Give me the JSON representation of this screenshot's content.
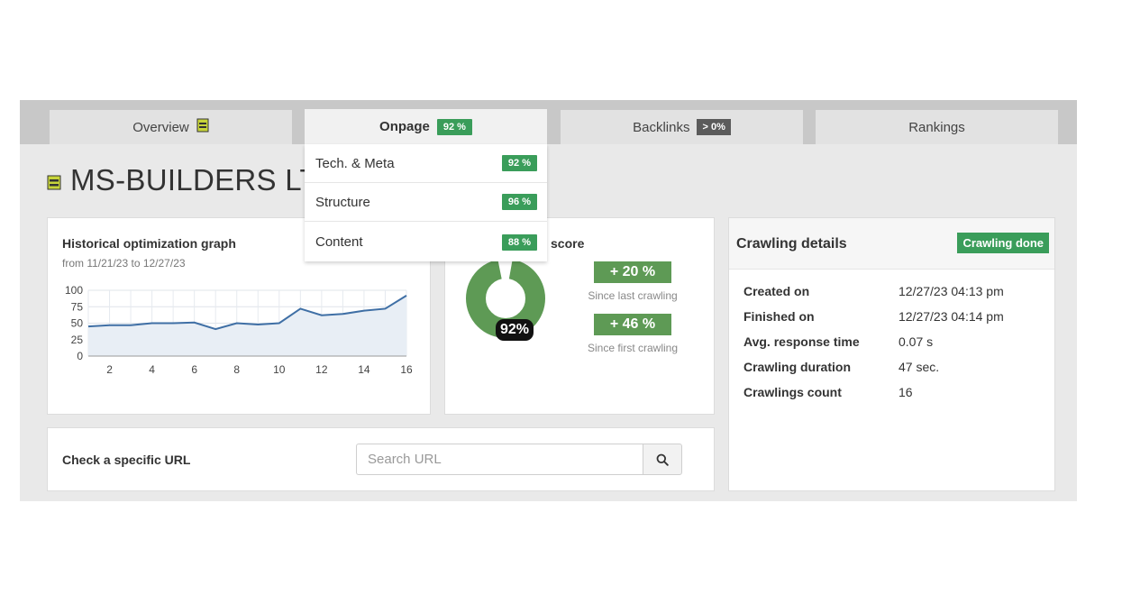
{
  "tabs": [
    {
      "label": "Overview",
      "icon": "document-icon",
      "active": false
    },
    {
      "label": "Onpage",
      "badge": "92 %",
      "active": true
    },
    {
      "label": "Backlinks",
      "badge": "> 0%",
      "active": false
    },
    {
      "label": "Rankings",
      "active": false
    }
  ],
  "page": {
    "title": "MS-BUILDERS LT",
    "title_icon": "document-icon"
  },
  "onpage_menu": [
    {
      "label": "Tech. & Meta",
      "badge": "92 %"
    },
    {
      "label": "Structure",
      "badge": "96 %"
    },
    {
      "label": "Content",
      "badge": "88 %"
    }
  ],
  "history": {
    "title": "Historical optimization graph",
    "subtitle": "from 11/21/23 to 12/27/23"
  },
  "chart_data": {
    "type": "area",
    "x": [
      1,
      2,
      3,
      4,
      5,
      6,
      7,
      8,
      9,
      10,
      11,
      12,
      13,
      14,
      15,
      16
    ],
    "series": [
      {
        "values": [
          45,
          47,
          47,
          50,
          50,
          51,
          41,
          50,
          48,
          50,
          72,
          62,
          64,
          69,
          72,
          92
        ]
      }
    ],
    "xticks": [
      2,
      4,
      6,
      8,
      10,
      12,
      14,
      16
    ],
    "yticks": [
      0,
      25,
      50,
      75,
      100
    ],
    "ylim": [
      0,
      100
    ],
    "grid": true,
    "color": "#3f6fa5"
  },
  "score": {
    "title_visible": "score",
    "value": 92,
    "label": "92%",
    "deltas": [
      {
        "value": "+ 20 %",
        "caption": "Since last crawling"
      },
      {
        "value": "+ 46 %",
        "caption": "Since first crawling"
      }
    ],
    "color": "#5e9a55"
  },
  "crawl": {
    "title": "Crawling details",
    "status": "Crawling done",
    "rows": [
      {
        "key": "Created on",
        "value": "12/27/23 04:13 pm"
      },
      {
        "key": "Finished on",
        "value": "12/27/23 04:14 pm"
      },
      {
        "key": "Avg. response time",
        "value": "0.07 s"
      },
      {
        "key": "Crawling duration",
        "value": "47 sec."
      },
      {
        "key": "Crawlings count",
        "value": "16"
      }
    ]
  },
  "url_check": {
    "label": "Check a specific URL",
    "placeholder": "Search URL",
    "value": "",
    "button_icon": "search-icon"
  },
  "colors": {
    "accent": "#3a9d5a",
    "line": "#3f6fa5",
    "donut": "#5e9a55"
  }
}
